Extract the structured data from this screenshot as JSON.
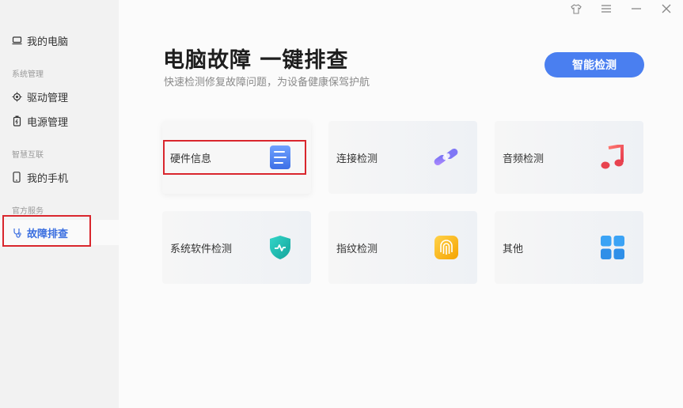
{
  "window": {
    "controls": [
      "shirt-icon",
      "menu-icon",
      "minimize-icon",
      "close-icon"
    ]
  },
  "sidebar": {
    "my_computer": "我的电脑",
    "section_system": "系统管理",
    "driver_management": "驱动管理",
    "power_management": "电源管理",
    "section_smart": "智慧互联",
    "my_phone": "我的手机",
    "section_official": "官方服务",
    "troubleshooting": "故障排查"
  },
  "main": {
    "title": "电脑故障 一键排查",
    "subtitle": "快速检测修复故障问题，为设备健康保驾护航",
    "smart_check_button": "智能检测",
    "cards": [
      {
        "label": "硬件信息",
        "icon": "document-icon"
      },
      {
        "label": "连接检测",
        "icon": "link-icon"
      },
      {
        "label": "音频检测",
        "icon": "music-note-icon"
      },
      {
        "label": "系统软件检测",
        "icon": "shield-icon"
      },
      {
        "label": "指纹检测",
        "icon": "fingerprint-icon"
      },
      {
        "label": "其他",
        "icon": "apps-grid-icon"
      }
    ]
  },
  "colors": {
    "accent": "#4a7ff0",
    "highlight_border": "#d9262d",
    "active_nav": "#3b6fe0"
  }
}
